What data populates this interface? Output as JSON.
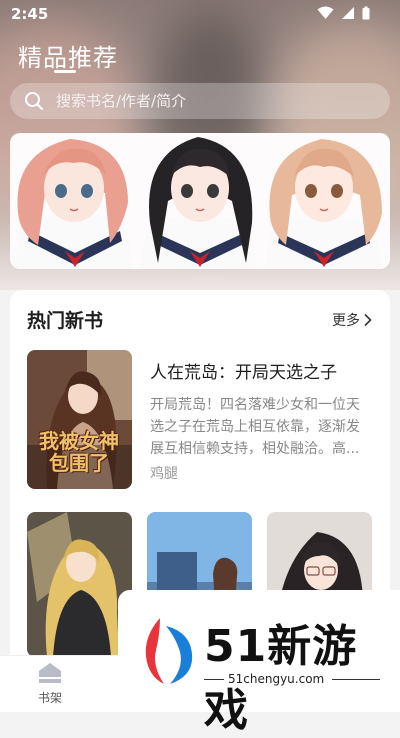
{
  "status_bar": {
    "time": "2:45"
  },
  "header": {
    "title": "精品推荐",
    "search": {
      "placeholder": "搜索书名/作者/简介"
    }
  },
  "hot_books": {
    "section_title": "热门新书",
    "more_label": "更多",
    "featured": {
      "title": "人在荒岛：开局天选之子",
      "description": "开局荒岛！四名落难少女和一位天选之子在荒岛上相互依靠，逐渐发展互相信赖支持，相处融洽。高...",
      "author": "鸡腿",
      "cover_text": "我被女神包围了"
    }
  },
  "bottom_nav": {
    "items": [
      {
        "label": "书架",
        "icon": "bookshelf-icon"
      }
    ]
  },
  "watermark": {
    "title": "51新游戏",
    "url": "51chengyu.com"
  },
  "colors": {
    "accent_red": "#e8343a",
    "accent_blue": "#1a7fd8"
  }
}
